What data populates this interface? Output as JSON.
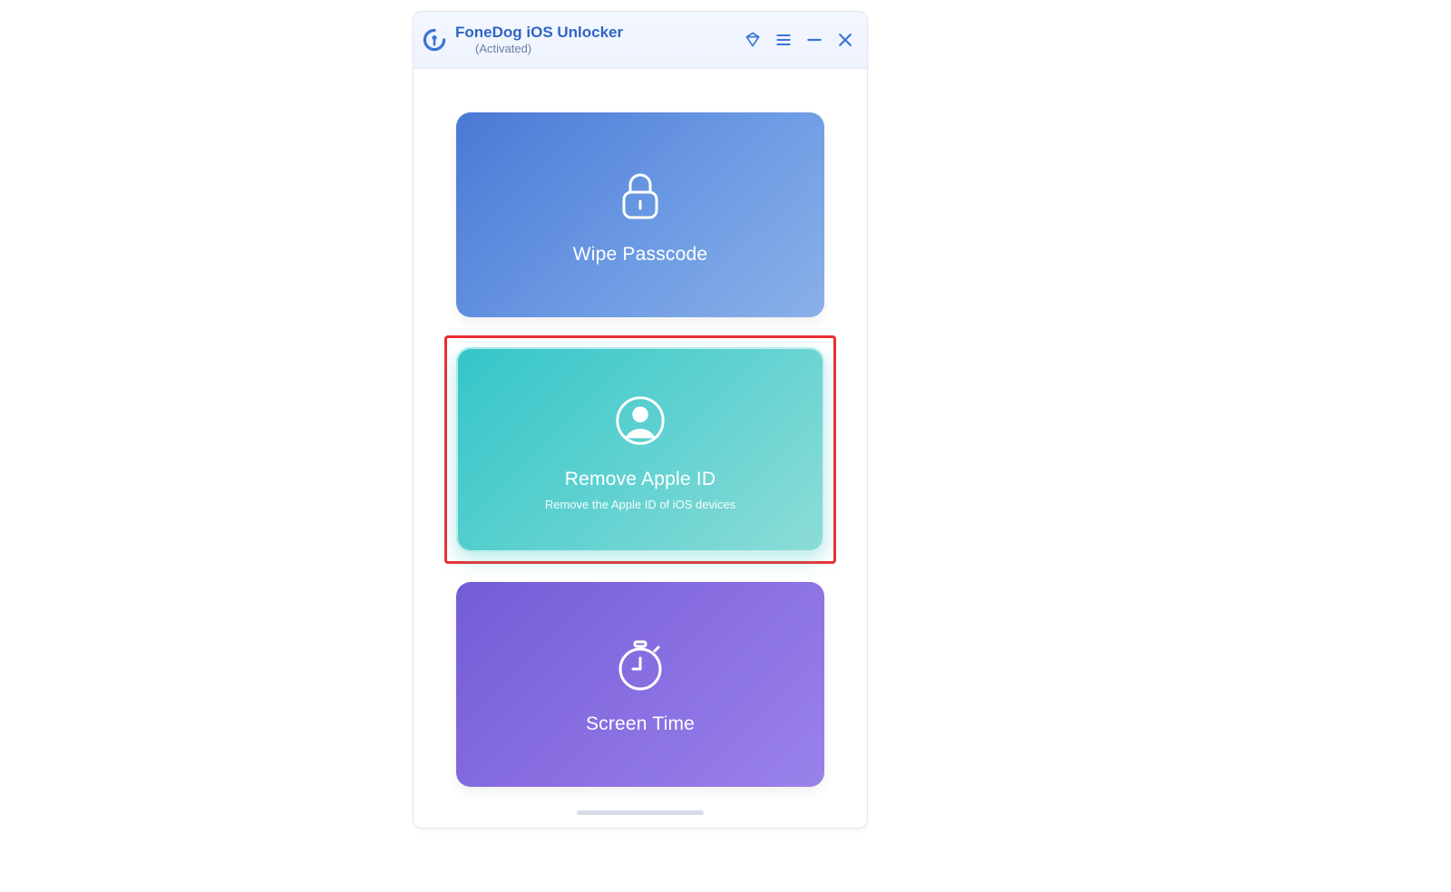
{
  "header": {
    "title": "FoneDog iOS Unlocker",
    "status": "(Activated)"
  },
  "cards": {
    "wipe": {
      "title": "Wipe Passcode"
    },
    "apple_id": {
      "title": "Remove Apple ID",
      "subtitle": "Remove the Apple ID of iOS devices"
    },
    "screen_time": {
      "title": "Screen Time"
    }
  }
}
